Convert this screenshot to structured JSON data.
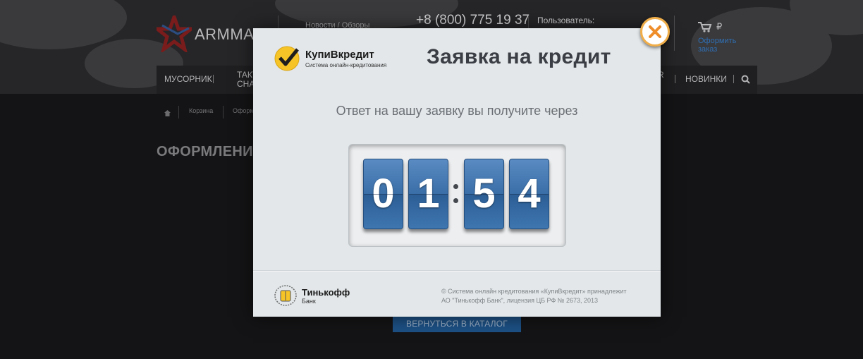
{
  "site": {
    "logo_text": "ARMMA.",
    "top_links": "Новости / Обзоры",
    "phone": "+8 (800) 775 19 37",
    "user_label": "Пользователь:",
    "cart_currency": "₽",
    "order_link": "Оформить заказ",
    "nav": {
      "item1": "МУСОРНИК",
      "item2a": "ТАКТ",
      "item2b": "СНА",
      "item_r": "R",
      "item_new": "НОВИНКИ"
    },
    "breadcrumb": {
      "item1": "Корзина",
      "item2": "Оформ"
    },
    "page_title": "ОФОРМЛЕНИ",
    "back_button": "ВЕРНУТЬСЯ В КАТАЛОГ"
  },
  "modal": {
    "brand_name": "КупиВкредит",
    "brand_sub": "Система онлайн-кредитования",
    "title": "Заявка на кредит",
    "subtitle": "Ответ на вашу заявку вы получите через",
    "timer": {
      "d1": "0",
      "d2": "1",
      "d3": "5",
      "d4": "4"
    },
    "bank_name": "Тинькофф",
    "bank_sub": "Банк",
    "copyright_line1": "© Система онлайн кредитования «КупиВкредит» принадлежит",
    "copyright_line2": "АО \"Тинькофф Банк\", лицензия ЦБ РФ № 2673, 2013"
  },
  "icons": {
    "close": "close-icon",
    "cart": "cart-icon",
    "search": "search-icon",
    "home": "home-icon",
    "check": "check-icon",
    "bank_emblem": "tinkoff-emblem-icon"
  },
  "colors": {
    "accent_orange": "#f0ae4a",
    "timer_blue": "#3a6ea7",
    "button_blue": "#1d5186",
    "link_blue": "#2f6db2",
    "brand_yellow": "#f6c427"
  }
}
